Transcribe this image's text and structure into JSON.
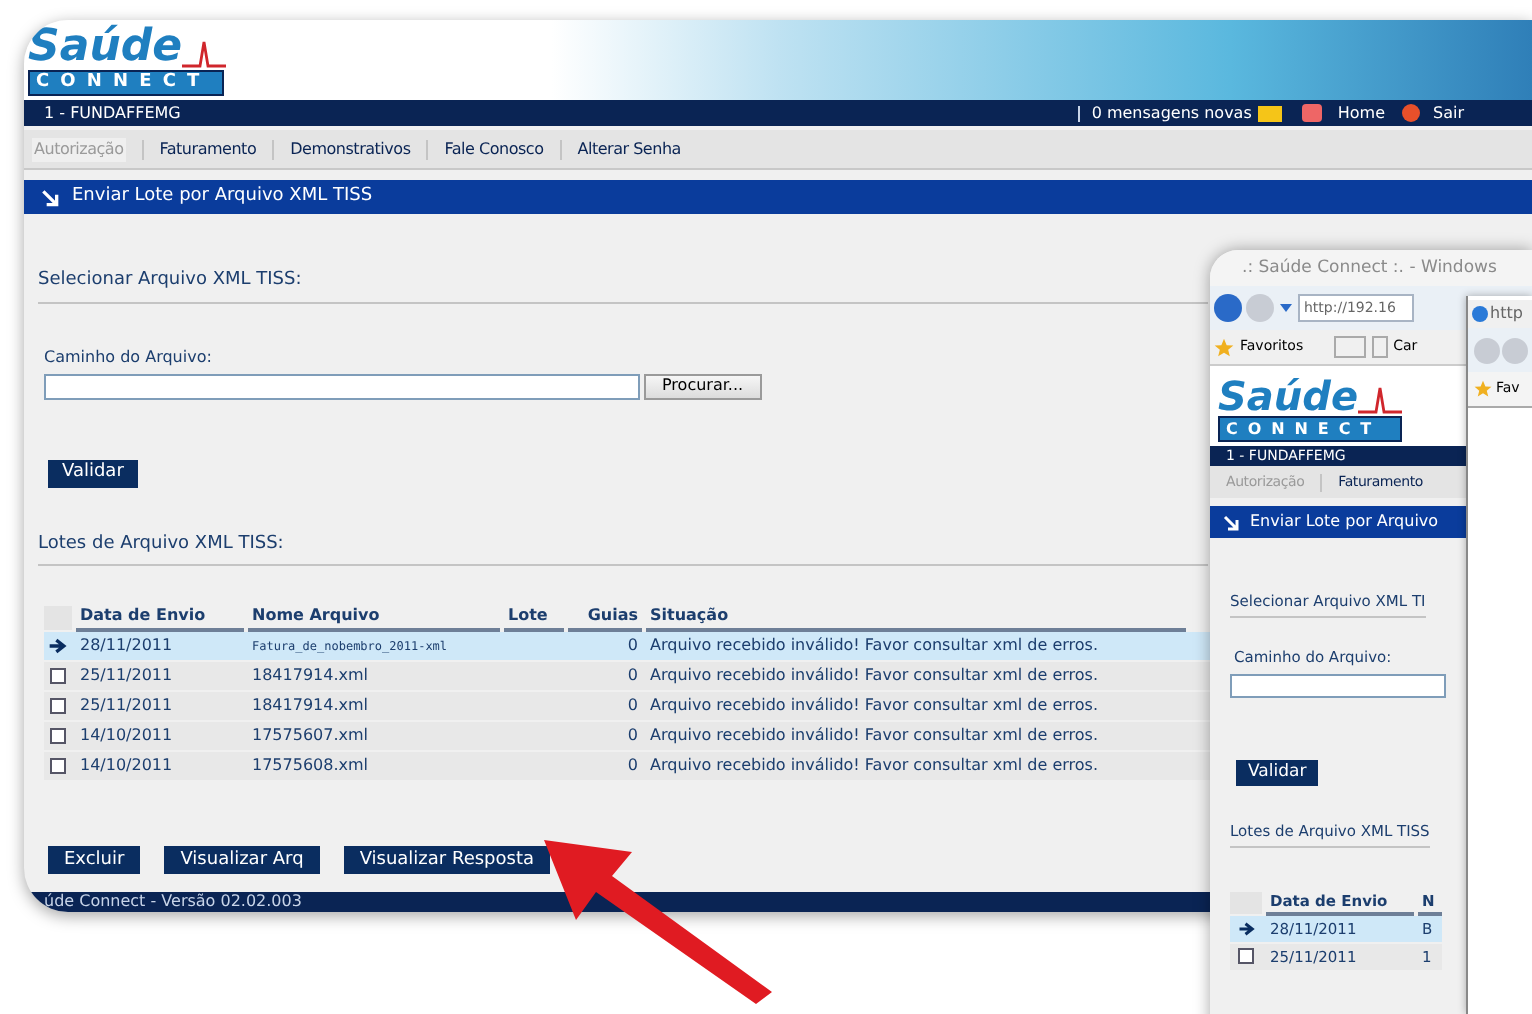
{
  "main_window": {
    "logo": {
      "word": "Saúde",
      "sub": "CONNECT"
    },
    "user_bar": {
      "account": "1 - FUNDAFFEMG",
      "messages": "0 mensagens novas",
      "home": "Home",
      "logout": "Sair"
    },
    "menu": [
      {
        "label": "Autorização",
        "disabled": true
      },
      {
        "label": "Faturamento",
        "disabled": false
      },
      {
        "label": "Demonstrativos",
        "disabled": false
      },
      {
        "label": "Fale Conosco",
        "disabled": false
      },
      {
        "label": "Alterar Senha",
        "disabled": false
      }
    ],
    "page_title": "Enviar Lote por Arquivo XML TISS",
    "select_section": {
      "heading": "Selecionar Arquivo XML TISS:",
      "field_label": "Caminho do Arquivo:",
      "browse_button": "Procurar...",
      "validate_button": "Validar"
    },
    "batches": {
      "heading": "Lotes de Arquivo XML TISS:",
      "columns": [
        "Data de Envio",
        "Nome Arquivo",
        "Lote",
        "Guias",
        "Situação"
      ],
      "rows": [
        {
          "selected": true,
          "date": "28/11/2011",
          "file": "Fatura_de_nobembro_2011-xml",
          "guias": "0",
          "status": "Arquivo recebido inválido! Favor consultar xml de erros."
        },
        {
          "selected": false,
          "date": "25/11/2011",
          "file": "18417914.xml",
          "guias": "0",
          "status": "Arquivo recebido inválido! Favor consultar xml de erros."
        },
        {
          "selected": false,
          "date": "25/11/2011",
          "file": "18417914.xml",
          "guias": "0",
          "status": "Arquivo recebido inválido! Favor consultar xml de erros."
        },
        {
          "selected": false,
          "date": "14/10/2011",
          "file": "17575607.xml",
          "guias": "0",
          "status": "Arquivo recebido inválido! Favor consultar xml de erros."
        },
        {
          "selected": false,
          "date": "14/10/2011",
          "file": "17575608.xml",
          "guias": "0",
          "status": "Arquivo recebido inválido! Favor consultar xml de erros."
        }
      ]
    },
    "buttons": [
      "Excluir",
      "Visualizar Arq",
      "Visualizar Resposta"
    ],
    "footer": "úde Connect - Versão 02.02.003"
  },
  "second_window": {
    "title": ".: Saúde Connect :. - Windows",
    "address": "http://192.16",
    "favorites": "Favoritos",
    "tab": "Car",
    "logo": {
      "word": "Saúde",
      "sub": "CONNECT"
    },
    "account": "1 - FUNDAFFEMG",
    "menu": [
      {
        "label": "Autorização",
        "disabled": true
      },
      {
        "label": "Faturamento",
        "disabled": false
      }
    ],
    "page_title": "Enviar Lote por Arquivo",
    "heading": "Selecionar Arquivo XML TI",
    "field_label": "Caminho do Arquivo:",
    "validate_button": "Validar",
    "batches_heading": "Lotes de Arquivo XML TISS",
    "columns": [
      "Data de Envio",
      "N"
    ],
    "rows": [
      {
        "selected": true,
        "date": "28/11/2011",
        "file": "B"
      },
      {
        "selected": false,
        "date": "25/11/2011",
        "file": "1"
      }
    ]
  },
  "third_window": {
    "address": "http",
    "favorites": "Fav"
  }
}
